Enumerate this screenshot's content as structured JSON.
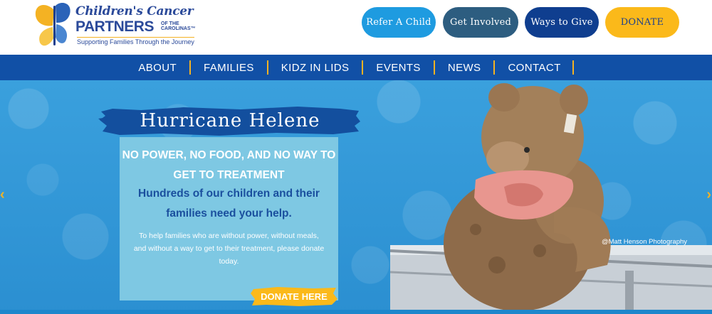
{
  "logo": {
    "line1": "Children's Cancer",
    "line2": "PARTNERS",
    "line2_suffix_a": "OF THE",
    "line2_suffix_b": "CAROLINAS™",
    "tagline": "Supporting Families Through the Journey"
  },
  "header_buttons": {
    "refer": "Refer A Child",
    "get_involved": "Get Involved",
    "ways_to_give": "Ways to Give",
    "donate": "DONATE"
  },
  "nav": {
    "items": [
      "ABOUT",
      "FAMILIES",
      "KIDZ IN LIDS",
      "EVENTS",
      "NEWS",
      "CONTACT"
    ]
  },
  "hero": {
    "title": "Hurricane Helene",
    "headline": "NO POWER, NO FOOD, AND NO WAY TO GET TO TREATMENT",
    "subheadline": "Hundreds of our children and their families need your help.",
    "body": "To help families who are without power, without meals, and without a way to get to their treatment, please donate today.",
    "cta": "DONATE HERE",
    "photo_credit": "@Matt Henson Photography",
    "prev_arrow": "‹",
    "next_arrow": "›"
  },
  "colors": {
    "nav_blue": "#1150a6",
    "accent_yellow": "#fbb91a",
    "hero_blue": "#3aa0dd",
    "card_blue": "#7ec8e3"
  },
  "icons": [
    "butterfly-logo-icon",
    "chevron-left-icon",
    "chevron-right-icon"
  ]
}
